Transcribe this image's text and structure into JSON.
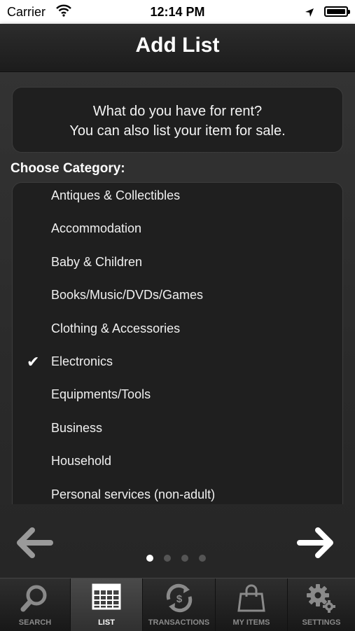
{
  "status": {
    "carrier": "Carrier",
    "time": "12:14 PM"
  },
  "nav": {
    "title": "Add List"
  },
  "intro": {
    "line1": "What do you have for rent?",
    "line2": "You can also list your item for sale."
  },
  "choose_label": "Choose Category:",
  "categories": [
    {
      "label": "Antiques & Collectibles",
      "selected": false
    },
    {
      "label": "Accommodation",
      "selected": false
    },
    {
      "label": "Baby & Children",
      "selected": false
    },
    {
      "label": "Books/Music/DVDs/Games",
      "selected": false
    },
    {
      "label": "Clothing & Accessories",
      "selected": false
    },
    {
      "label": "Electronics",
      "selected": true
    },
    {
      "label": "Equipments/Tools",
      "selected": false
    },
    {
      "label": "Business",
      "selected": false
    },
    {
      "label": "Household",
      "selected": false
    },
    {
      "label": "Personal services (non-adult)",
      "selected": false
    }
  ],
  "check_glyph": "✔",
  "pager": {
    "count": 4,
    "active_index": 0
  },
  "tabs": [
    {
      "label": "SEARCH",
      "icon": "search-icon",
      "active": false
    },
    {
      "label": "LIST",
      "icon": "list-icon",
      "active": true
    },
    {
      "label": "TRANSACTIONS",
      "icon": "transactions-icon",
      "active": false
    },
    {
      "label": "MY ITEMS",
      "icon": "bag-icon",
      "active": false
    },
    {
      "label": "SETTINGS",
      "icon": "gear-icon",
      "active": false
    }
  ]
}
